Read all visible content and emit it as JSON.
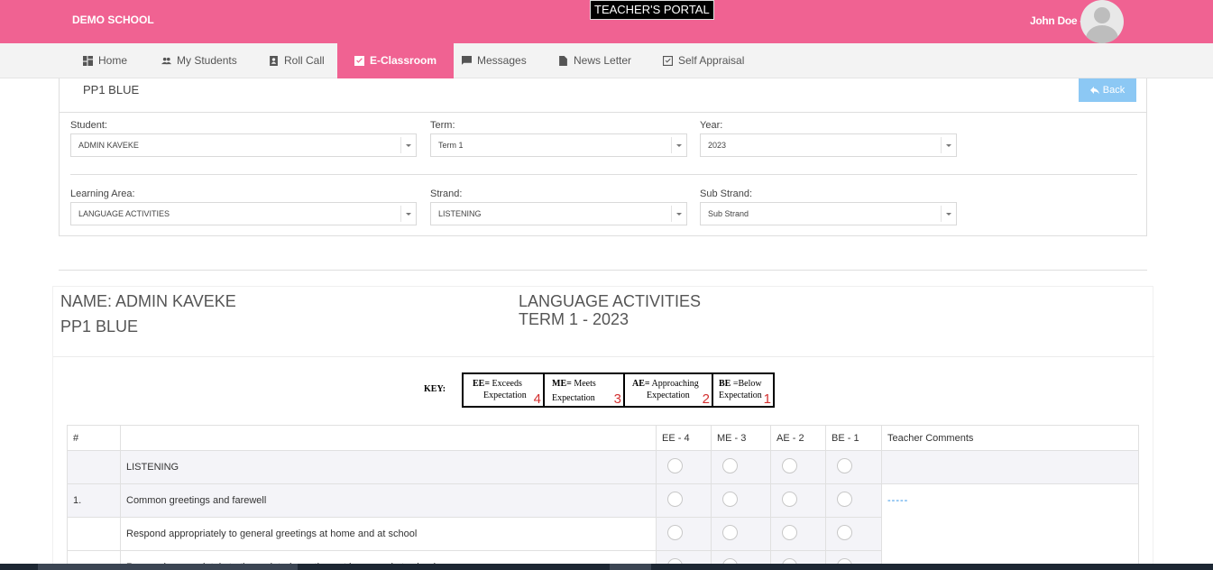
{
  "header": {
    "school": "DEMO SCHOOL",
    "portal": "TEACHER'S PORTAL",
    "user": "John Doe -"
  },
  "nav": {
    "items": [
      {
        "label": "Home",
        "icon": "dashboard-icon"
      },
      {
        "label": "My Students",
        "icon": "people-icon"
      },
      {
        "label": "Roll Call",
        "icon": "contact-icon"
      },
      {
        "label": "E-Classroom",
        "icon": "checkbox-icon",
        "active": true
      },
      {
        "label": "Messages",
        "icon": "message-icon"
      },
      {
        "label": "News Letter",
        "icon": "document-icon"
      },
      {
        "label": "Self Appraisal",
        "icon": "checkbox-outline-icon"
      }
    ]
  },
  "panel": {
    "title": "PP1 BLUE",
    "back_label": "Back",
    "student_label": "Student:",
    "student_value": "ADMIN KAVEKE",
    "term_label": "Term:",
    "term_value": "Term 1",
    "year_label": "Year:",
    "year_value": "2023",
    "area_label": "Learning Area:",
    "area_value": "LANGUAGE ACTIVITIES",
    "strand_label": "Strand:",
    "strand_value": "LISTENING",
    "substrand_label": "Sub Strand:",
    "substrand_value": "Sub Strand"
  },
  "report": {
    "name": "NAME: ADMIN KAVEKE",
    "class": "PP1 BLUE",
    "area": "LANGUAGE ACTIVITIES",
    "term": "TERM 1 - 2023"
  },
  "key": {
    "label": "KEY:",
    "ee_abbr": "EE=",
    "ee_text": "Exceeds",
    "ee_text2": "Expectation",
    "ee_num": "4",
    "me_abbr": "ME=",
    "me_text": "Meets",
    "me_text2": "Expectation",
    "me_num": "3",
    "ae_abbr": "AE=",
    "ae_text": "Approaching",
    "ae_text2": "Expectation",
    "ae_num": "2",
    "be_abbr": "BE",
    "be_text": "=Below",
    "be_text2": "Expectation",
    "be_num": "1"
  },
  "table": {
    "headers": [
      "#",
      "",
      "EE - 4",
      "ME - 3",
      "AE - 2",
      "BE - 1",
      "Teacher Comments"
    ],
    "rows": [
      {
        "num": "",
        "text": "LISTENING",
        "comment": ""
      },
      {
        "num": "1.",
        "text": "Common greetings and farewell",
        "comment": "-----"
      },
      {
        "num": "",
        "text": "Respond appropriately to general greetings at home and at school",
        "comment": ""
      },
      {
        "num": "",
        "text": "Respond appropriately to time related greetings at home and at school",
        "comment": ""
      }
    ]
  }
}
